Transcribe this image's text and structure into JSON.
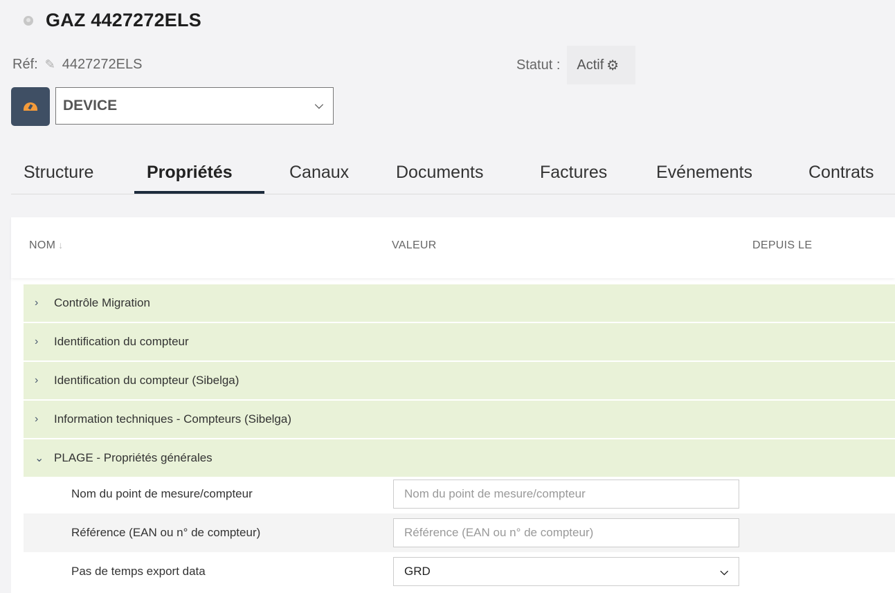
{
  "header": {
    "title": "GAZ 4427272ELS",
    "icon": "globe-icon"
  },
  "ref": {
    "label": "Réf:",
    "value": "4427272ELS"
  },
  "status": {
    "label": "Statut :",
    "value": "Actif"
  },
  "type_select": {
    "value": "DEVICE",
    "icon": "gauge-icon"
  },
  "tabs": [
    {
      "label": "Structure"
    },
    {
      "label": "Propriétés",
      "active": true
    },
    {
      "label": "Canaux"
    },
    {
      "label": "Documents"
    },
    {
      "label": "Factures"
    },
    {
      "label": "Evénements"
    },
    {
      "label": "Contrats"
    }
  ],
  "table": {
    "columns": {
      "name": "NOM",
      "value": "VALEUR",
      "since": "DEPUIS LE"
    },
    "groups": [
      {
        "label": "Contrôle Migration",
        "expanded": false
      },
      {
        "label": "Identification du compteur",
        "expanded": false
      },
      {
        "label": "Identification du compteur (Sibelga)",
        "expanded": false
      },
      {
        "label": "Information techniques - Compteurs (Sibelga)",
        "expanded": false
      },
      {
        "label": "PLAGE - Propriétés générales",
        "expanded": true
      }
    ],
    "properties": [
      {
        "label": "Nom du point de mesure/compteur",
        "placeholder": "Nom du point de mesure/compteur"
      },
      {
        "label": "Référence (EAN ou n° de compteur)",
        "placeholder": "Référence (EAN ou n° de compteur)"
      },
      {
        "label": "Pas de temps export data",
        "selected": "GRD"
      }
    ]
  },
  "colors": {
    "tab_underline": "#1d2b3c",
    "group_bg": "#e9f2d8",
    "type_button_bg": "#3f4f64",
    "gauge": "#f49b3a"
  }
}
